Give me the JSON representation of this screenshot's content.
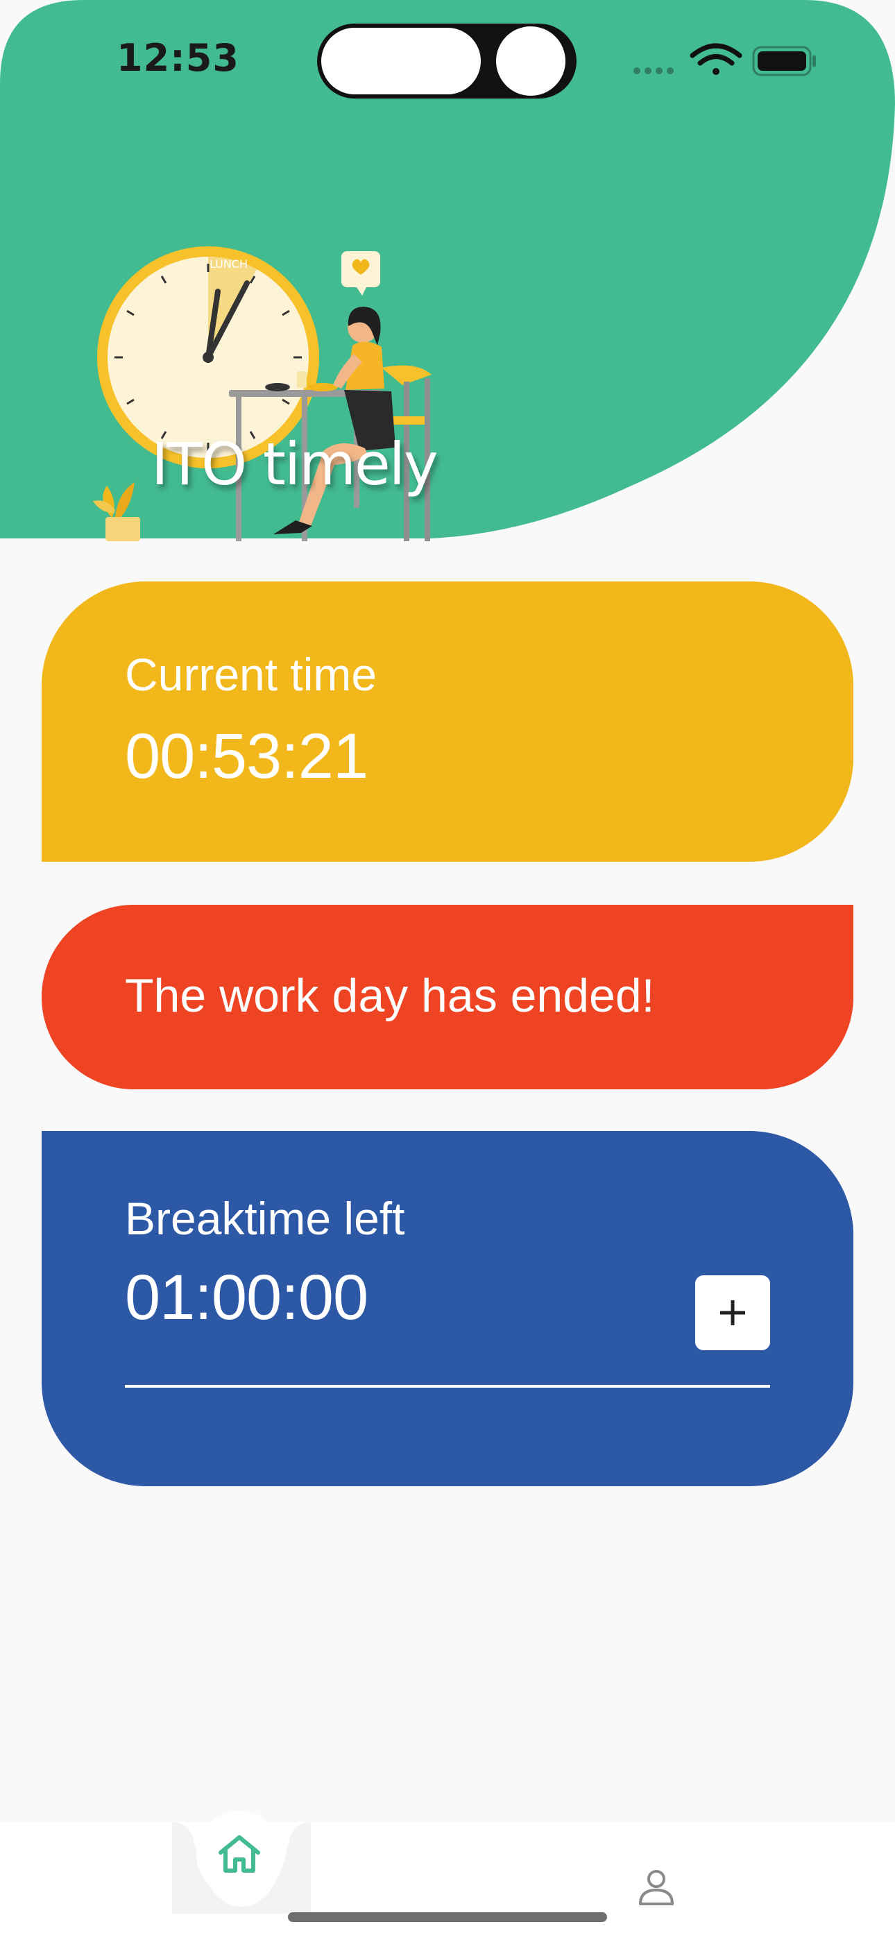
{
  "status_bar": {
    "time": "12:53"
  },
  "header": {
    "app_title": "ITO timely",
    "illustration_clock_label": "LUNCH",
    "background_color": "#43bb91"
  },
  "current_time_card": {
    "label": "Current time",
    "value": "00:53:21",
    "color": "#f2b81b"
  },
  "status_card": {
    "message": "The work day has ended!",
    "color": "#ee4423"
  },
  "break_card": {
    "label": "Breaktime left",
    "value": "01:00:00",
    "add_label": "+",
    "color": "#2c58a5"
  },
  "bottom_nav": {
    "items": [
      {
        "name": "home",
        "icon": "home-icon",
        "active": true,
        "color": "#43bb91"
      },
      {
        "name": "profile",
        "icon": "person-icon",
        "active": false,
        "color": "#8a8a8a"
      }
    ]
  }
}
